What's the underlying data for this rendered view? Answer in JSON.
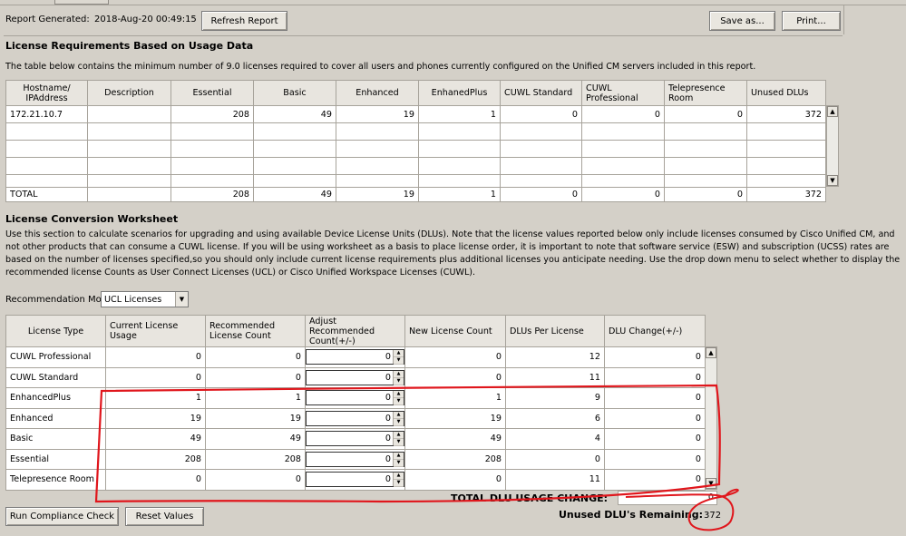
{
  "header": {
    "report_generated_label": "Report Generated:",
    "report_generated_value": "2018-Aug-20 00:49:15",
    "refresh_button": "Refresh Report",
    "save_as_button": "Save as...",
    "print_button": "Print..."
  },
  "requirements": {
    "title": "License Requirements Based on Usage Data",
    "description": "The table below contains the minimum number of 9.0 licenses required to cover all users and phones currently configured on the Unified CM servers included in this report.",
    "columns": [
      "Hostname/ IPAddress",
      "Description",
      "Essential",
      "Basic",
      "Enhanced",
      "EnhanedPlus",
      "CUWL Standard",
      "CUWL Professional",
      "Telepresence Room",
      "Unused DLUs"
    ],
    "rows": [
      [
        "172.21.10.7",
        "",
        "208",
        "49",
        "19",
        "1",
        "0",
        "0",
        "0",
        "372"
      ]
    ],
    "total": [
      "TOTAL",
      "",
      "208",
      "49",
      "19",
      "1",
      "0",
      "0",
      "0",
      "372"
    ]
  },
  "worksheet": {
    "title": "License Conversion Worksheet",
    "description": "Use this section to calculate scenarios for upgrading and using available Device License Units (DLUs). Note that the license values reported below only include licenses consumed by Cisco Unified CM, and not other products that can consume a CUWL license. If you will be using worksheet as a basis to place license order, it is important to note that software service (ESW) and subscription (UCSS) rates are based on the number of licenses specified,so you should only include current license requirements plus additional licenses you anticipate needing. Use the drop down menu to select whether to display the recommended license Counts as User Connect Licenses (UCL) or Cisco Unified Workspace Licenses (CUWL).",
    "mode_label": "Recommendation Mode",
    "mode_value": "UCL Licenses",
    "columns": [
      "License Type",
      "Current License Usage",
      "Recommended License Count",
      "Adjust Recommended Count(+/-)",
      "New License Count",
      "DLUs Per License",
      "DLU Change(+/-)"
    ],
    "rows": [
      {
        "type": "CUWL Professional",
        "current": "0",
        "recommended": "0",
        "adjust": "0",
        "new": "0",
        "dlu_per": "12",
        "dlu_change": "0"
      },
      {
        "type": "CUWL Standard",
        "current": "0",
        "recommended": "0",
        "adjust": "0",
        "new": "0",
        "dlu_per": "11",
        "dlu_change": "0"
      },
      {
        "type": "EnhancedPlus",
        "current": "1",
        "recommended": "1",
        "adjust": "0",
        "new": "1",
        "dlu_per": "9",
        "dlu_change": "0"
      },
      {
        "type": "Enhanced",
        "current": "19",
        "recommended": "19",
        "adjust": "0",
        "new": "19",
        "dlu_per": "6",
        "dlu_change": "0"
      },
      {
        "type": "Basic",
        "current": "49",
        "recommended": "49",
        "adjust": "0",
        "new": "49",
        "dlu_per": "4",
        "dlu_change": "0"
      },
      {
        "type": "Essential",
        "current": "208",
        "recommended": "208",
        "adjust": "0",
        "new": "208",
        "dlu_per": "0",
        "dlu_change": "0"
      },
      {
        "type": "Telepresence Room",
        "current": "0",
        "recommended": "0",
        "adjust": "0",
        "new": "0",
        "dlu_per": "11",
        "dlu_change": "0"
      }
    ],
    "total_dlu_label": "TOTAL DLU USAGE CHANGE:",
    "total_dlu_value": "0",
    "unused_label": "Unused DLU's Remaining:",
    "unused_value": "372",
    "run_button": "Run Compliance Check",
    "reset_button": "Reset Values"
  },
  "annotation_color": "#e0161c"
}
